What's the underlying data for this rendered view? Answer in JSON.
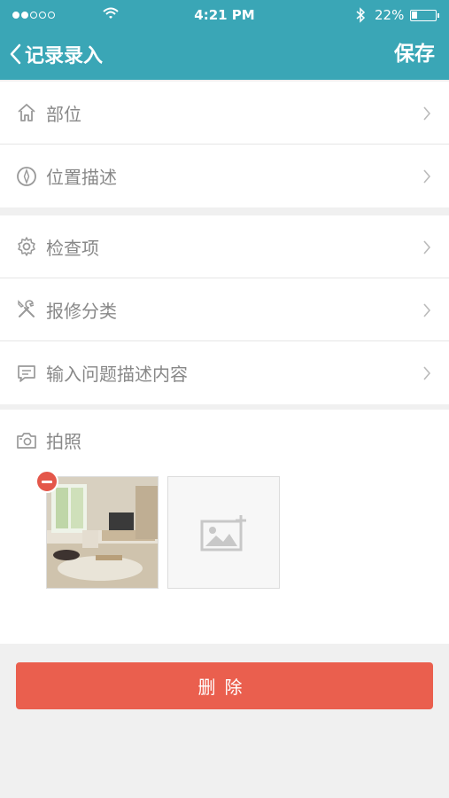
{
  "status_bar": {
    "time": "4:21 PM",
    "battery_pct": "22%",
    "battery_level": 0.22,
    "signal_dots_filled": 2,
    "signal_dots_total": 5,
    "icons": [
      "wifi-icon",
      "bluetooth-icon",
      "battery-icon"
    ]
  },
  "nav": {
    "back_label": "记录录入",
    "save_label": "保存"
  },
  "group1": [
    {
      "label": "部位",
      "icon": "home-icon"
    },
    {
      "label": "位置描述",
      "icon": "compass-icon"
    }
  ],
  "group2": [
    {
      "label": "检查项",
      "icon": "gear-icon"
    },
    {
      "label": "报修分类",
      "icon": "tools-icon"
    },
    {
      "label": "输入问题描述内容",
      "icon": "comment-icon"
    }
  ],
  "photo": {
    "label": "拍照",
    "icon": "camera-icon"
  },
  "delete_label": "删除",
  "colors": {
    "accent": "#3aa6b6",
    "danger": "#ea5f4e",
    "text_gray": "#888888",
    "background": "#f0f0f0"
  }
}
